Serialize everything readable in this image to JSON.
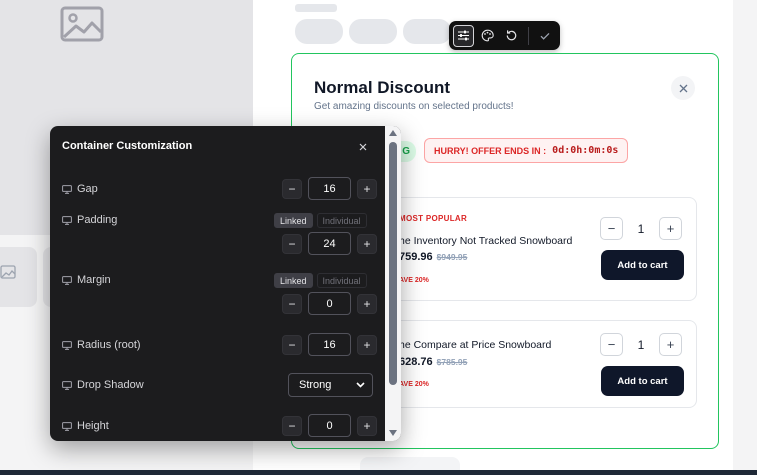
{
  "toolbar": {
    "icons": [
      "sliders-icon",
      "palette-icon",
      "reset-icon",
      "check-icon"
    ],
    "active": "sliders-icon"
  },
  "card": {
    "title": "Normal Discount",
    "subtitle": "Get amazing discounts on selected products!",
    "saved_badge": "G",
    "timer_label": "HURRY! OFFER ENDS IN :",
    "timer_value": "0d:0h:0m:0s",
    "products": [
      {
        "badge": "MOST POPULAR",
        "name": "he Inventory Not Tracked Snowboard",
        "price": "759.96",
        "compare_price": "$949.95",
        "save": "AVE 20%",
        "quantity": "1",
        "add_label": "Add to cart"
      },
      {
        "name": "he Compare at Price Snowboard",
        "price": "628.76",
        "compare_price": "$785.95",
        "save": "AVE 20%",
        "quantity": "1",
        "add_label": "Add to cart"
      }
    ],
    "accent_color": "#22c55e"
  },
  "panel": {
    "title": "Container Customization",
    "rows": {
      "gap": {
        "label": "Gap",
        "value": "16"
      },
      "padding": {
        "label": "Padding",
        "value": "24",
        "linked": "Linked",
        "individual": "Individual"
      },
      "margin": {
        "label": "Margin",
        "value": "0",
        "linked": "Linked",
        "individual": "Individual"
      },
      "radius": {
        "label": "Radius (root)",
        "value": "16"
      },
      "drop_shadow": {
        "label": "Drop Shadow",
        "value": "Strong"
      },
      "height": {
        "label": "Height",
        "value": "0"
      }
    },
    "minus": "−",
    "plus": "+",
    "close": "×"
  }
}
